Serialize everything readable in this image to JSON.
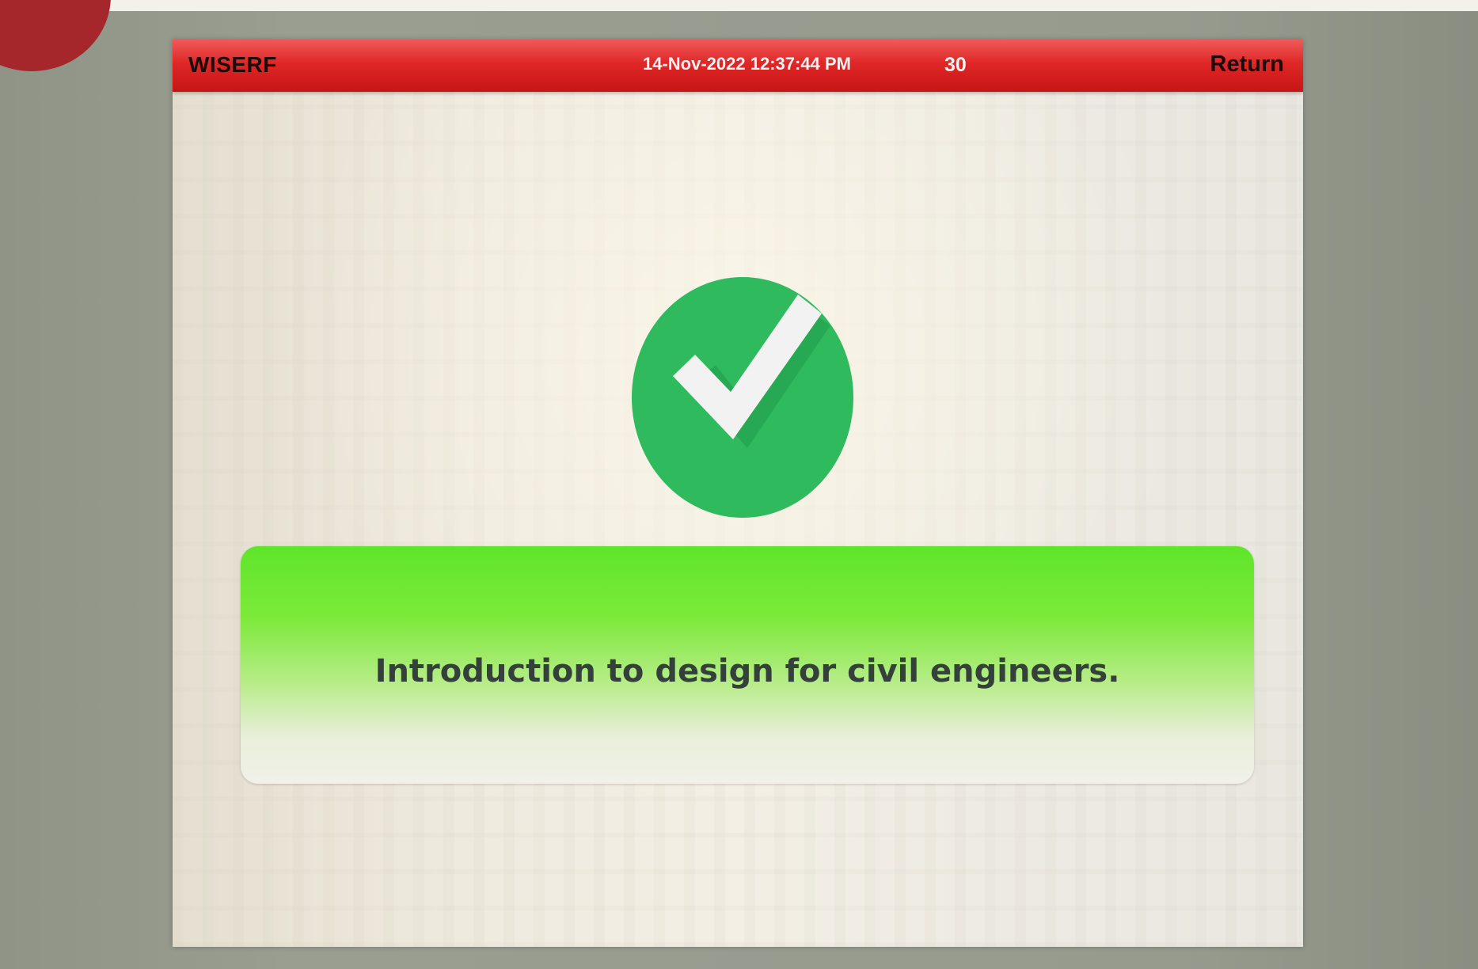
{
  "header": {
    "brand": "WISERF",
    "datetime": "14-Nov-2022 12:37:44 PM",
    "counter": "30",
    "return_label": "Return"
  },
  "status": {
    "icon": "check-circle-icon",
    "message": "Introduction to design for civil engineers."
  },
  "colors": {
    "header_red": "#df2727",
    "success_green": "#2fba5d",
    "banner_green": "#6fe534"
  }
}
